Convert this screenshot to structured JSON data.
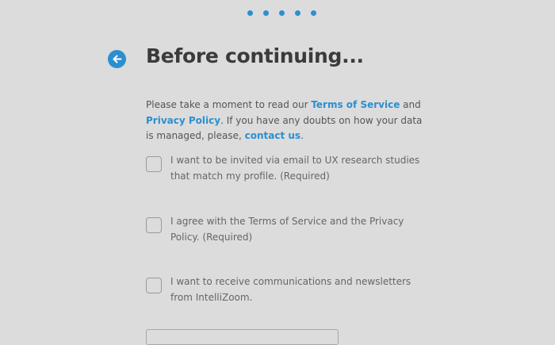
{
  "progress": {
    "total_steps": 5,
    "dots": [
      "step-1",
      "step-2",
      "step-3",
      "step-4",
      "step-5"
    ]
  },
  "header": {
    "back_icon": "arrow-left-icon",
    "title": "Before continuing..."
  },
  "intro": {
    "text_1": "Please take a moment to read our ",
    "terms_link": "Terms of Service",
    "text_2": " and ",
    "privacy_link": "Privacy Policy",
    "text_3": ". If you have any doubts on how your data is managed, please, ",
    "contact_link": "contact us",
    "text_4": "."
  },
  "consents": [
    {
      "label": "I want to be invited via email to UX research studies that match my profile. (Required)",
      "checked": false
    },
    {
      "label": "I agree with the Terms of Service and the Privacy Policy. (Required)",
      "checked": false
    },
    {
      "label": "I want to receive communications and newsletters from IntelliZoom.",
      "checked": false
    }
  ],
  "colors": {
    "accent": "#2b8fd0",
    "background": "#dcdcdc",
    "title": "#3b3b3b",
    "text": "#555555"
  }
}
